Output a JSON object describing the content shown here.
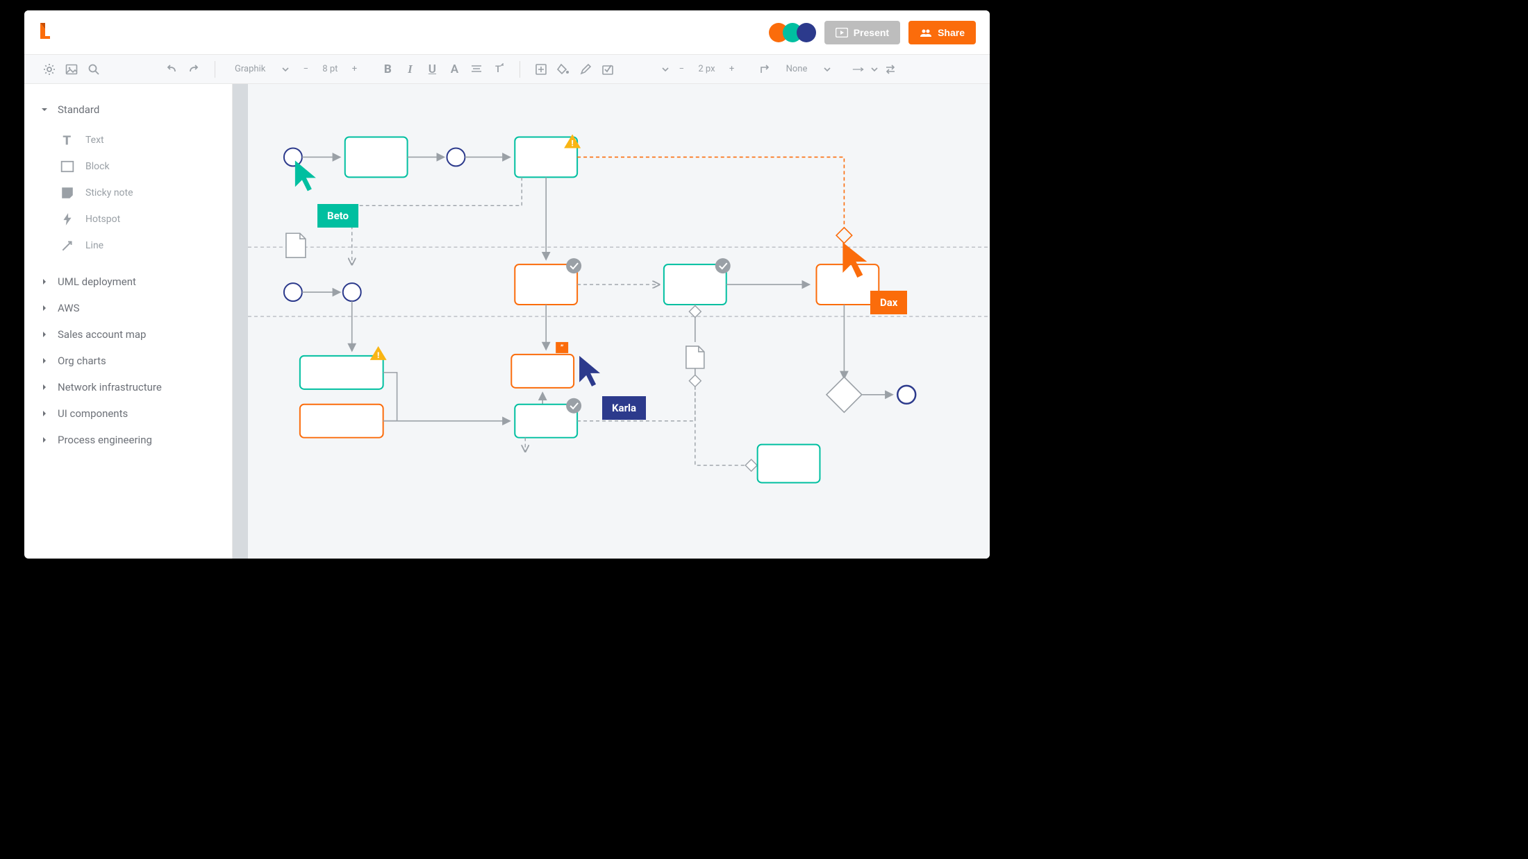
{
  "header": {
    "present_label": "Present",
    "share_label": "Share"
  },
  "toolbar": {
    "font": "Graphik",
    "font_size": "8 pt",
    "stroke_width": "2 px",
    "line_style": "None"
  },
  "sidebar": {
    "sections": [
      {
        "label": "Standard",
        "open": true
      },
      {
        "label": "UML deployment"
      },
      {
        "label": "AWS"
      },
      {
        "label": "Sales account map"
      },
      {
        "label": "Org charts"
      },
      {
        "label": "Network infrastructure"
      },
      {
        "label": "UI components"
      },
      {
        "label": "Process engineering"
      }
    ],
    "standard_items": [
      {
        "label": "Text"
      },
      {
        "label": "Block"
      },
      {
        "label": "Sticky note"
      },
      {
        "label": "Hotspot"
      },
      {
        "label": "Line"
      }
    ]
  },
  "collaborators": {
    "beto": {
      "label": "Beto",
      "color": "#00bfa0"
    },
    "karla": {
      "label": "Karla",
      "color": "#2c3a8c"
    },
    "dax": {
      "label": "Dax",
      "color": "#fb6c0b"
    }
  },
  "colors": {
    "orange": "#fb6c0b",
    "teal": "#00bfa0",
    "navy": "#2c3a8c",
    "gray": "#9aa0a6"
  }
}
